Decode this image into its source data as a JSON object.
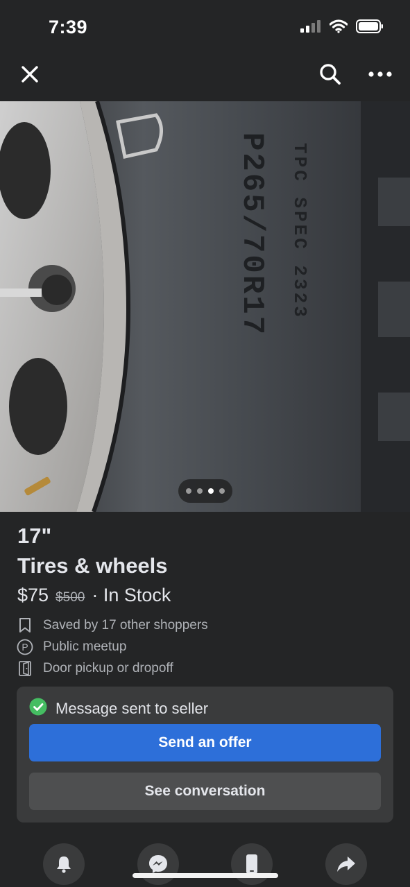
{
  "status": {
    "time": "7:39",
    "icons": [
      "cellular-signal-icon",
      "wifi-icon",
      "battery-icon"
    ]
  },
  "topbar": {
    "icons": [
      "close-icon",
      "search-icon",
      "more-icon"
    ]
  },
  "photo": {
    "sidewall_text_1": "TPC SPEC 2323",
    "sidewall_text_2": "P265/70R17",
    "carousel": {
      "count": 4,
      "active_index": 2
    }
  },
  "listing": {
    "title_line1": "17\"",
    "title_line2": "Tires & wheels",
    "price": "$75",
    "original_price": "$500",
    "availability": "· In Stock",
    "details": [
      {
        "icon": "bookmark-icon",
        "text": "Saved by 17 other shoppers"
      },
      {
        "icon": "public-meetup-icon",
        "text": "Public meetup"
      },
      {
        "icon": "door-icon",
        "text": "Door pickup or dropoff"
      }
    ]
  },
  "message_card": {
    "status_icon": "check-circle-icon",
    "status_text": "Message sent to seller",
    "primary_button": "Send an offer",
    "secondary_button": "See conversation"
  },
  "bottom_bar": {
    "icons": [
      "bell-icon",
      "messenger-icon",
      "phone-icon",
      "share-icon"
    ]
  },
  "colors": {
    "background": "#242526",
    "card": "#3a3b3c",
    "primary": "#2d6fd9",
    "success": "#45bd62"
  }
}
